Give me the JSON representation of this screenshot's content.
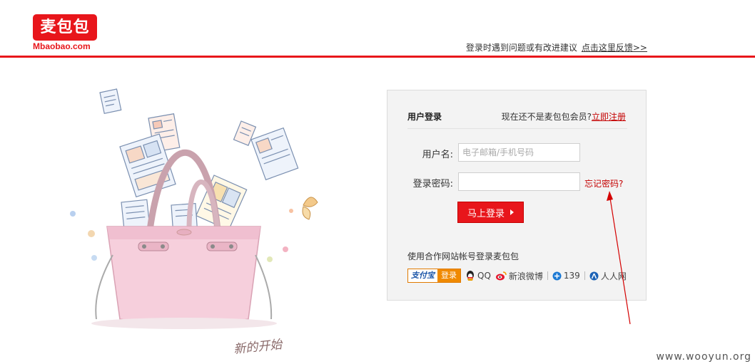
{
  "header": {
    "logo_text": "麦包包",
    "logo_url": "Mbaobao.com",
    "feedback_text": "登录时遇到问题或有改进建议",
    "feedback_link": "点击这里反馈>>"
  },
  "illustration": {
    "caption": "新的开始"
  },
  "login": {
    "title": "用户登录",
    "register_prompt": "现在还不是麦包包会员?",
    "register_link": "立即注册",
    "username_label": "用户名:",
    "username_placeholder": "电子邮箱/手机号码",
    "password_label": "登录密码:",
    "password_value": "",
    "forgot_link": "忘记密码?",
    "submit_label": "马上登录"
  },
  "partners": {
    "title": "使用合作网站帐号登录麦包包",
    "alipay_brand": "支付宝",
    "alipay_action": "登录",
    "items": [
      "QQ",
      "新浪微博",
      "139",
      "人人网"
    ]
  },
  "watermark": "www.wooyun.org",
  "colors": {
    "brand_red": "#e8161b",
    "link_red": "#c40000",
    "box_bg": "#f3f3f3"
  }
}
